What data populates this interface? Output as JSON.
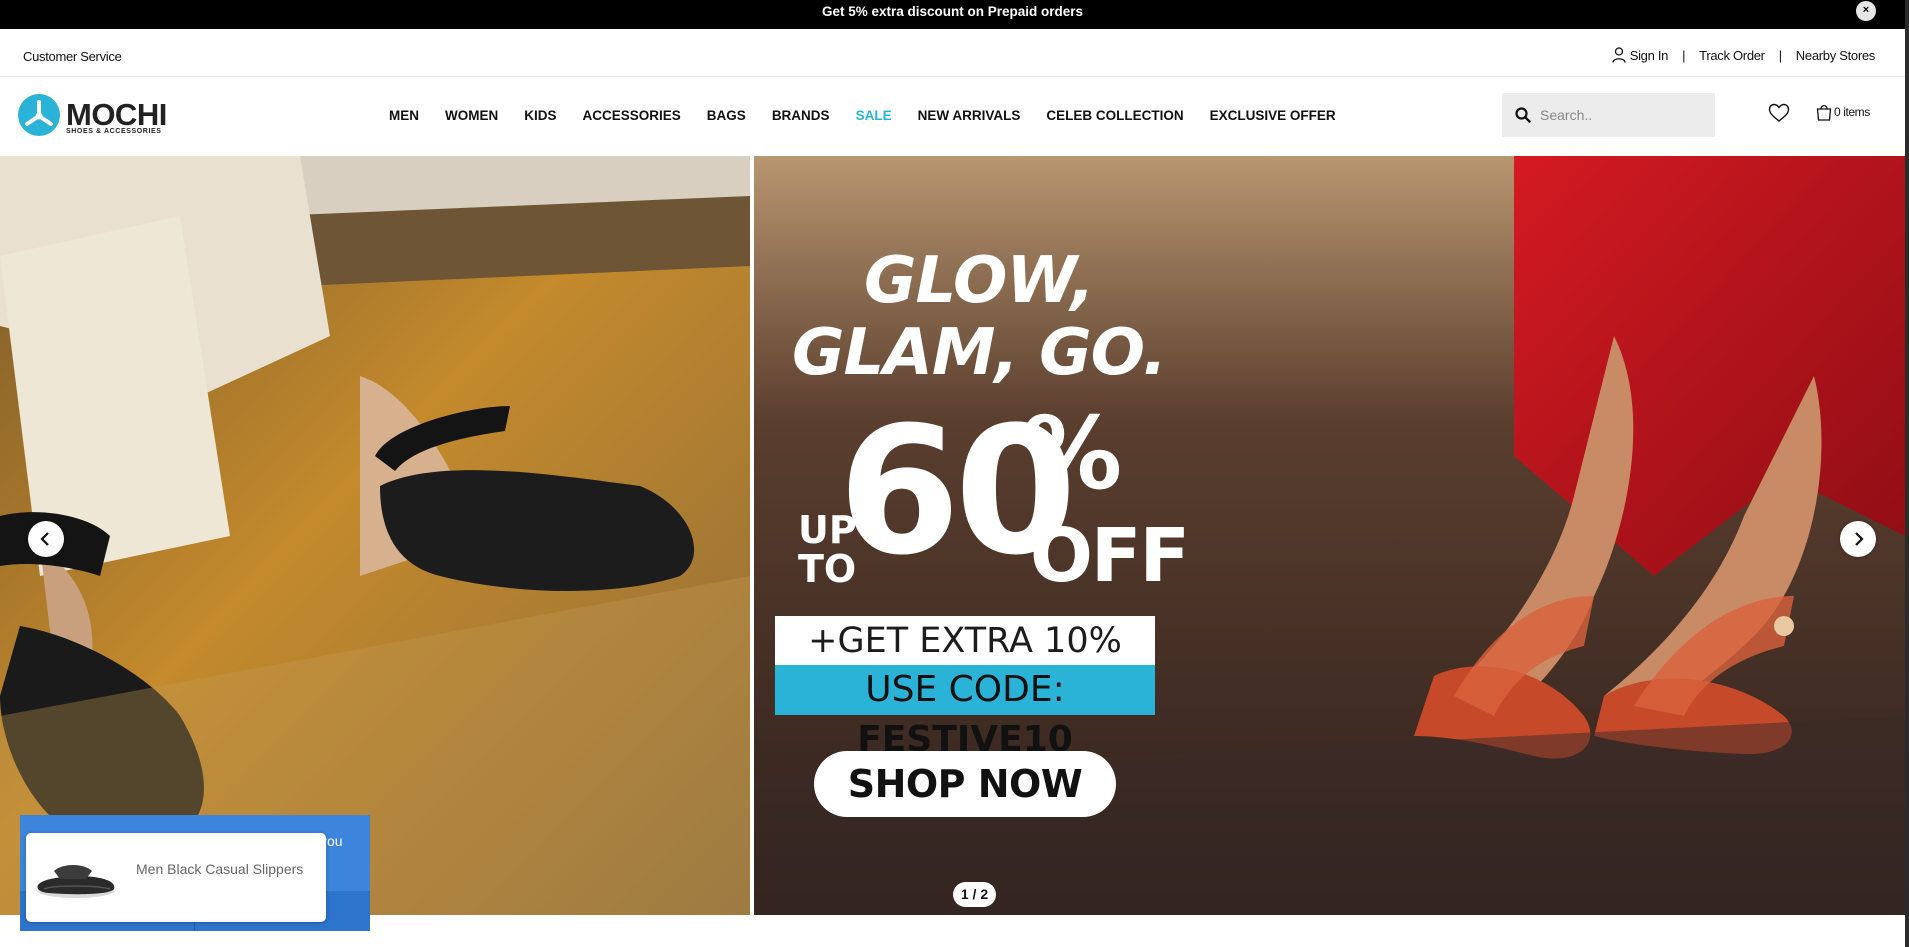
{
  "announcement": {
    "text": "Get 5% extra discount on Prepaid orders",
    "close_glyph": "×"
  },
  "utility": {
    "customer_service": "Customer Service",
    "sign_in": "Sign In",
    "track_order": "Track Order",
    "nearby_stores": "Nearby Stores",
    "separator": "|"
  },
  "header": {
    "logo_text": "MOCHI",
    "logo_tagline": "SHOES & ACCESSORIES",
    "nav": [
      "MEN",
      "WOMEN",
      "KIDS",
      "ACCESSORIES",
      "BAGS",
      "BRANDS",
      "SALE",
      "NEW ARRIVALS",
      "CELEB COLLECTION",
      "EXCLUSIVE OFFER"
    ],
    "search_placeholder": "Search..",
    "cart_label": "0 items",
    "icons": {
      "search": "search-icon",
      "wishlist": "heart-icon",
      "cart": "shopping-bag-icon",
      "user": "user-icon"
    }
  },
  "hero": {
    "headline_1": "GLOW,",
    "headline_2": "GLAM, GO.",
    "up": "UP",
    "to": "TO",
    "percent_number": "60",
    "percent_sign": "%",
    "off": "OFF",
    "extra_offer": "+GET EXTRA 10% OFF",
    "code_prefix": "USE CODE: ",
    "code": "FESTIVE10",
    "cta": "SHOP NOW",
    "counter": "1 / 2"
  },
  "popup": {
    "product_name": "Men Black Casual Slippers",
    "partial_text": "you"
  },
  "colors": {
    "accent": "#28b4d8",
    "announce_bg": "#000000",
    "popup_blue": "#3c84dc"
  }
}
